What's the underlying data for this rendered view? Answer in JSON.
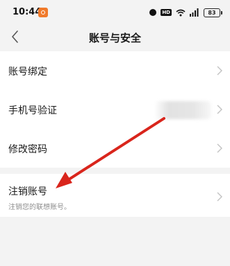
{
  "status_bar": {
    "time": "10:44",
    "battery": "83",
    "network_badge": "HD"
  },
  "nav": {
    "title": "账号与安全"
  },
  "settings": {
    "items": [
      {
        "label": "账号绑定"
      },
      {
        "label": "手机号验证"
      },
      {
        "label": "修改密码"
      }
    ]
  },
  "account_cancel": {
    "label": "注销账号",
    "description": "注销您的联想账号。"
  },
  "colors": {
    "background": "#f3f3f3",
    "card": "#ffffff",
    "annotation_arrow": "#d9251c",
    "app_badge": "#f07a2b"
  }
}
